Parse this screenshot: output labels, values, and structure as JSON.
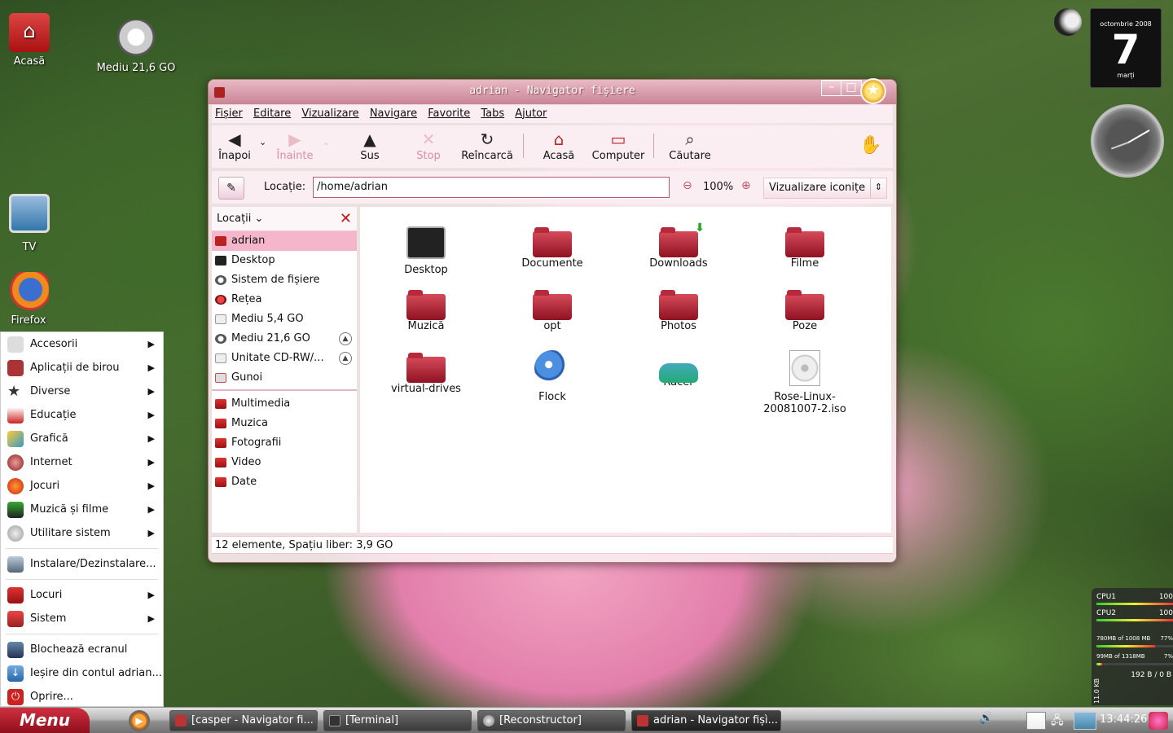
{
  "desktop": {
    "icons": [
      {
        "label": "Acasă",
        "icon": "home-folder-icon"
      },
      {
        "label": "Mediu 21,6 GO",
        "icon": "harddisk-icon"
      },
      {
        "label": "TV",
        "icon": "tv-icon"
      },
      {
        "label": "Firefox",
        "icon": "firefox-icon"
      }
    ]
  },
  "window": {
    "title": "adrian - Navigator fișiere",
    "menubar": [
      "Fișier",
      "Editare",
      "Vizualizare",
      "Navigare",
      "Favorite",
      "Tabs",
      "Ajutor"
    ],
    "toolbar": {
      "back": "Înapoi",
      "forward": "Înainte",
      "up": "Sus",
      "stop": "Stop",
      "reload": "Reîncarcă",
      "home": "Acasă",
      "computer": "Computer",
      "search": "Căutare"
    },
    "location": {
      "label": "Locație:",
      "value": "/home/adrian",
      "zoom": "100%",
      "view_mode": "Vizualizare iconițe"
    },
    "side_pane": {
      "selector": "Locații",
      "places": [
        {
          "label": "adrian",
          "icon": "home-icon"
        },
        {
          "label": "Desktop",
          "icon": "desktop-icon"
        },
        {
          "label": "Sistem de fișiere",
          "icon": "filesystem-icon"
        },
        {
          "label": "Rețea",
          "icon": "network-icon"
        },
        {
          "label": "Mediu 5,4 GO",
          "icon": "drive-icon"
        },
        {
          "label": "Mediu 21,6 GO",
          "icon": "drive-icon"
        },
        {
          "label": "Unitate CD-RW/...",
          "icon": "cdrom-icon"
        },
        {
          "label": "Gunoi",
          "icon": "trash-icon"
        }
      ],
      "bookmarks": [
        "Multimedia",
        "Muzica",
        "Fotografii",
        "Video",
        "Date"
      ]
    },
    "files": [
      {
        "name": "Desktop",
        "icon": "desktop-folder-icon"
      },
      {
        "name": "Documente",
        "icon": "folder-icon"
      },
      {
        "name": "Downloads",
        "icon": "downloads-folder-icon"
      },
      {
        "name": "Filme",
        "icon": "folder-icon"
      },
      {
        "name": "Muzică",
        "icon": "folder-icon"
      },
      {
        "name": "opt",
        "icon": "folder-icon"
      },
      {
        "name": "Photos",
        "icon": "folder-icon"
      },
      {
        "name": "Poze",
        "icon": "folder-icon"
      },
      {
        "name": "virtual-drives",
        "icon": "folder-icon"
      },
      {
        "name": "Flock",
        "icon": "flock-icon"
      },
      {
        "name": "Racer",
        "icon": "racer-icon"
      },
      {
        "name": "Rose-Linux-20081007-2.iso",
        "name_line1": "Rose-Linux-",
        "name_line2": "20081007-2.iso",
        "icon": "iso-icon"
      }
    ],
    "status": "12 elemente, Spațiu liber: 3,9 GO"
  },
  "main_menu": {
    "items": [
      {
        "label": "Accesorii",
        "submenu": true
      },
      {
        "label": "Aplicații de birou",
        "submenu": true
      },
      {
        "label": "Diverse",
        "submenu": true
      },
      {
        "label": "Educație",
        "submenu": true
      },
      {
        "label": "Grafică",
        "submenu": true
      },
      {
        "label": "Internet",
        "submenu": true
      },
      {
        "label": "Jocuri",
        "submenu": true
      },
      {
        "label": "Muzică și filme",
        "submenu": true
      },
      {
        "label": "Utilitare sistem",
        "submenu": true
      }
    ],
    "install": "Instalare/Dezinstalare...",
    "places": [
      {
        "label": "Locuri",
        "submenu": true
      },
      {
        "label": "Sistem",
        "submenu": true
      }
    ],
    "session": [
      {
        "label": "Blochează ecranul"
      },
      {
        "label": "Ieșire din contul adrian..."
      },
      {
        "label": "Oprire..."
      }
    ]
  },
  "taskbar": {
    "menu_label": "Menu",
    "tasks": [
      {
        "label": "[casper - Navigator fi..."
      },
      {
        "label": "[Terminal]"
      },
      {
        "label": "[Reconstructor]"
      },
      {
        "label": "adrian - Navigator fișì..."
      }
    ],
    "clock": "13:44:26"
  },
  "widgets": {
    "calendar": {
      "month": "octombrie 2008",
      "day": "7",
      "weekday": "marți"
    },
    "sysmon": {
      "cpu1_label": "CPU1",
      "cpu1_value": "100",
      "cpu1_level": 1.0,
      "cpu2_label": "CPU2",
      "cpu2_value": "100",
      "cpu2_level": 1.0,
      "mem_label": "780MB of 1008 MB",
      "mem_pct": "77%",
      "mem_level": 0.77,
      "swap_label": "99MB of 1318MB",
      "swap_pct": "7%",
      "swap_level": 0.07,
      "rate": "192 B / 0 B",
      "rate_unit": "11.0 KB"
    }
  },
  "colors": {
    "accent": "#c98596",
    "selection": "#f5b5cb",
    "folder": "#a11a2a"
  }
}
